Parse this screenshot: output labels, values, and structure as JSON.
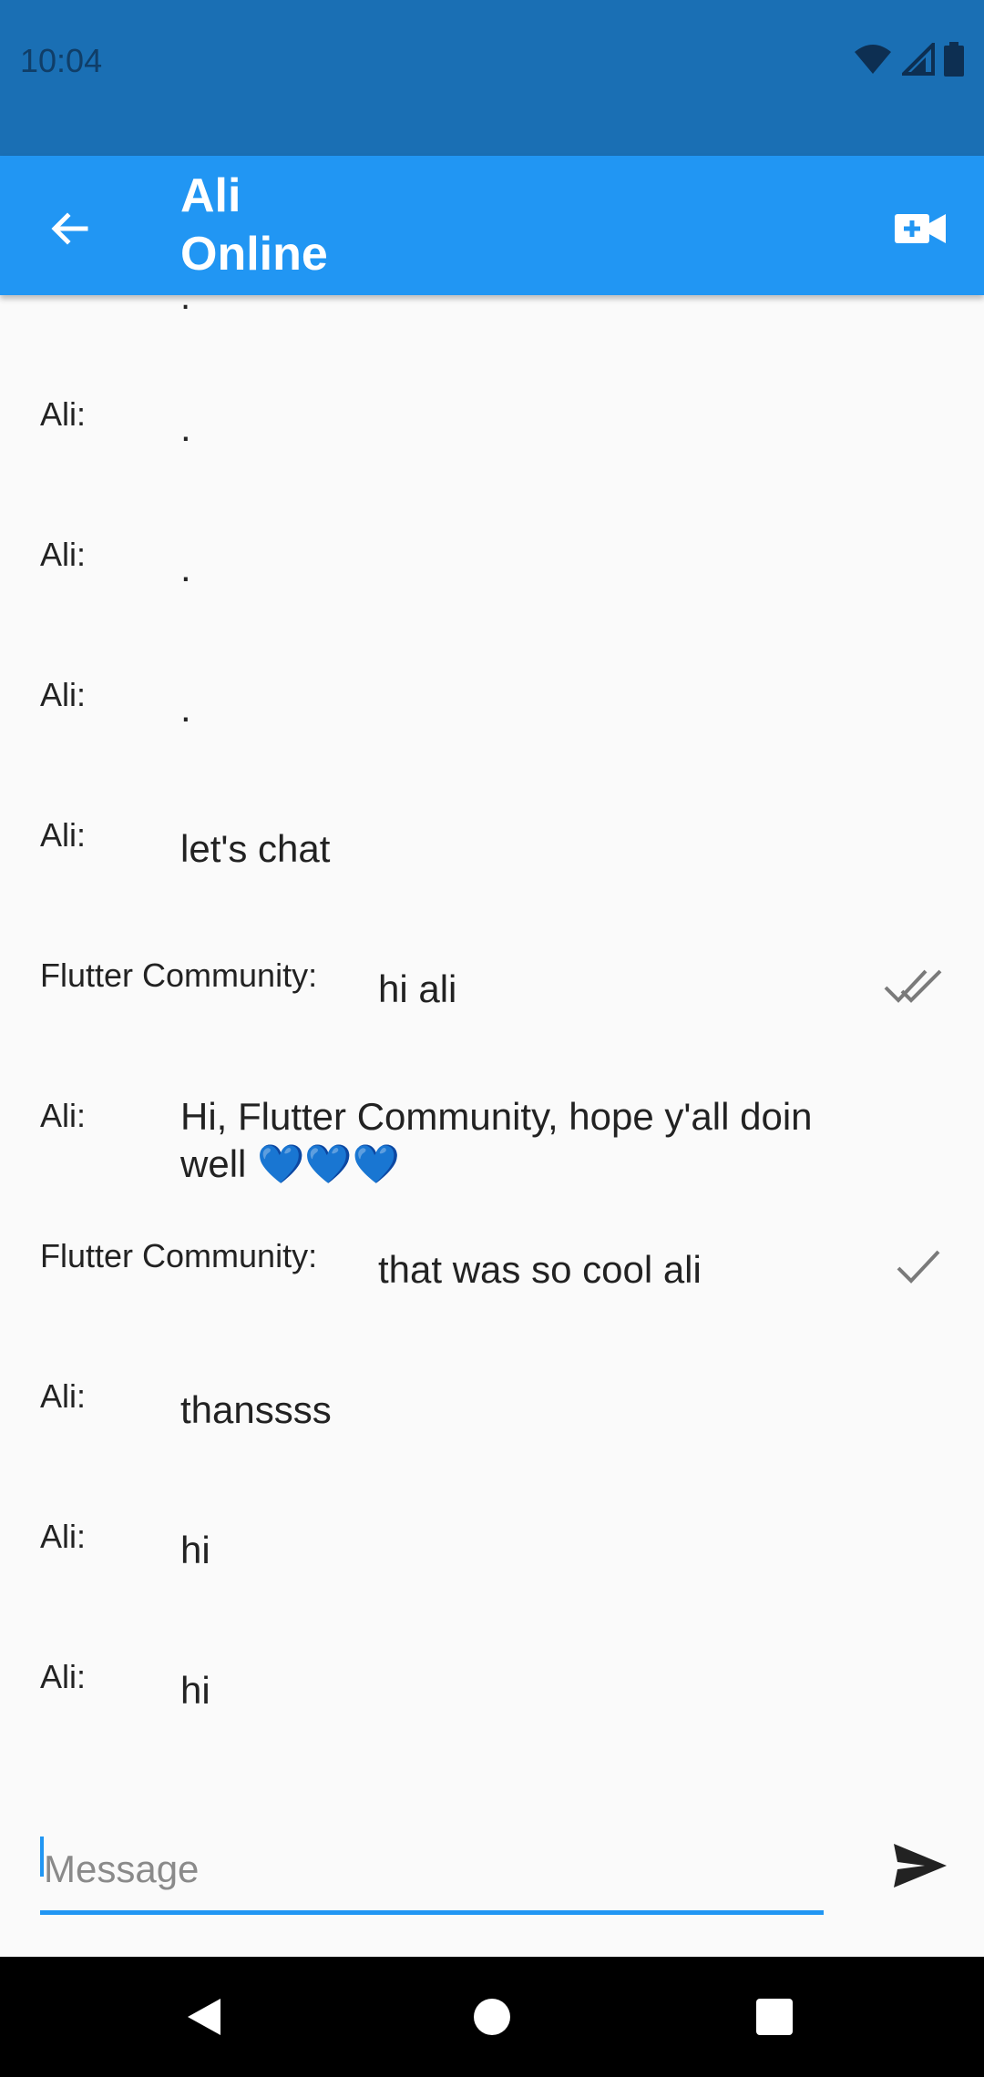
{
  "status_bar": {
    "time": "10:04"
  },
  "app_bar": {
    "name": "Ali",
    "status": "Online"
  },
  "messages": [
    {
      "sender": "Ali:",
      "text": ".",
      "receipt": ""
    },
    {
      "sender": "Ali:",
      "text": ".",
      "receipt": ""
    },
    {
      "sender": "Ali:",
      "text": ".",
      "receipt": ""
    },
    {
      "sender": "Ali:",
      "text": "let's chat",
      "receipt": ""
    },
    {
      "sender": "Flutter Community:",
      "text": "hi ali",
      "receipt": "double-check-icon"
    },
    {
      "sender": "Ali:",
      "text": "Hi, Flutter Community, hope y'all doin well 💙💙💙",
      "receipt": ""
    },
    {
      "sender": "Flutter Community:",
      "text": "that was so cool ali",
      "receipt": "check-icon"
    },
    {
      "sender": "Ali:",
      "text": "thanssss",
      "receipt": ""
    },
    {
      "sender": "Ali:",
      "text": "hi",
      "receipt": ""
    },
    {
      "sender": "Ali:",
      "text": "hi",
      "receipt": ""
    }
  ],
  "composer": {
    "placeholder": "Message",
    "value": ""
  },
  "colors": {
    "app_bar": "#2196f3",
    "status_bar": "#1a6fb4",
    "accent": "#2196f3"
  }
}
